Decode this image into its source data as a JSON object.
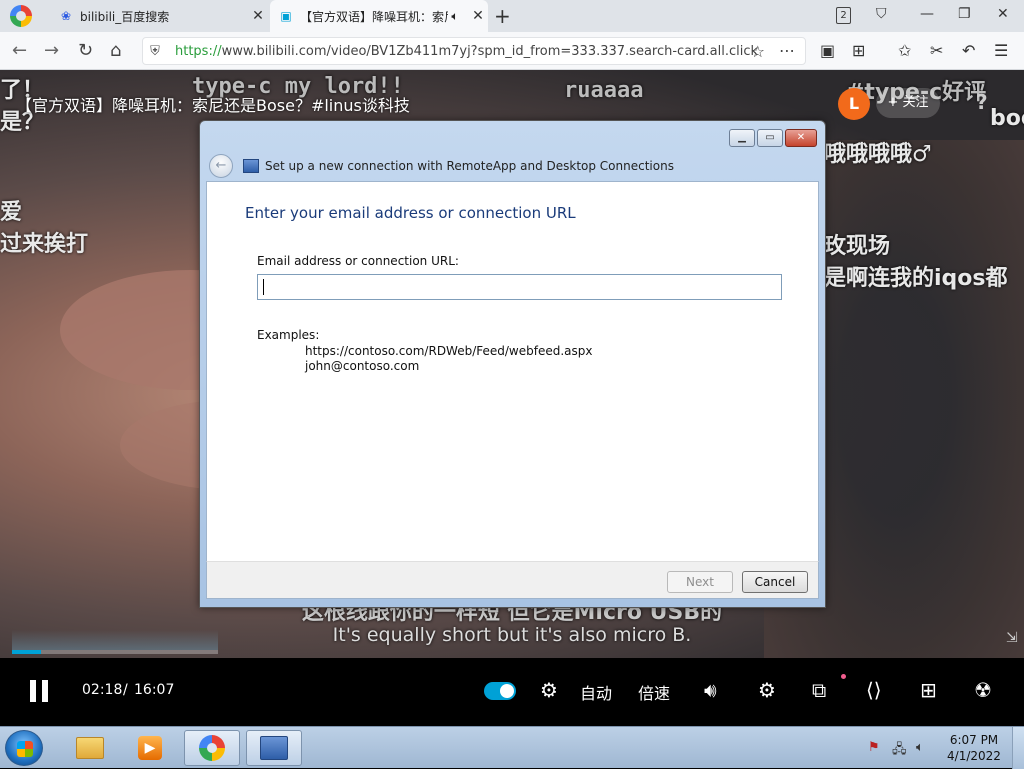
{
  "browser": {
    "tabs": [
      {
        "title": "bilibili_百度搜索",
        "icon": "baidu-paw-icon"
      },
      {
        "title": "【官方双语】降噪耳机：索尼还是Bose？",
        "icon": "bilibili-tv-icon"
      }
    ],
    "tab_count": "2",
    "url_https": "https://",
    "url_rest": "www.bilibili.com/video/BV1Zb411m7yj?spm_id_from=333.337.search-card.all.click"
  },
  "video": {
    "title": "【官方双语】降噪耳机：索尼还是Bose？#linus谈科技",
    "follow_label": "+ 关注",
    "danmaku": [
      "了！",
      "type-c my lord!!",
      "ruaaaa",
      "#type-c好评",
      "是？",
      "哦哦哦哦♂",
      "boo",
      "爱",
      "过来挨打",
      "玫现场",
      "是啊连我的iqos都"
    ],
    "subtitle_zh": "这根线跟你的一样短 但它是Micro USB的",
    "subtitle_en": "It's equally short but it's also micro B.",
    "progress_fraction": 0.14
  },
  "player": {
    "current_time": "02:18",
    "separator": "/",
    "duration": "16:07",
    "quality_label": "自动",
    "speed_label": "倍速"
  },
  "dialog": {
    "header_title": "Set up a new connection with RemoteApp and Desktop Connections",
    "heading": "Enter your email address or connection URL",
    "field_label": "Email address or connection URL:",
    "field_value": "",
    "examples_label": "Examples:",
    "examples": [
      "https://contoso.com/RDWeb/Feed/webfeed.aspx",
      "john@contoso.com"
    ],
    "next_label": "Next",
    "cancel_label": "Cancel"
  },
  "taskbar": {
    "time": "6:07 PM",
    "date": "4/1/2022"
  }
}
